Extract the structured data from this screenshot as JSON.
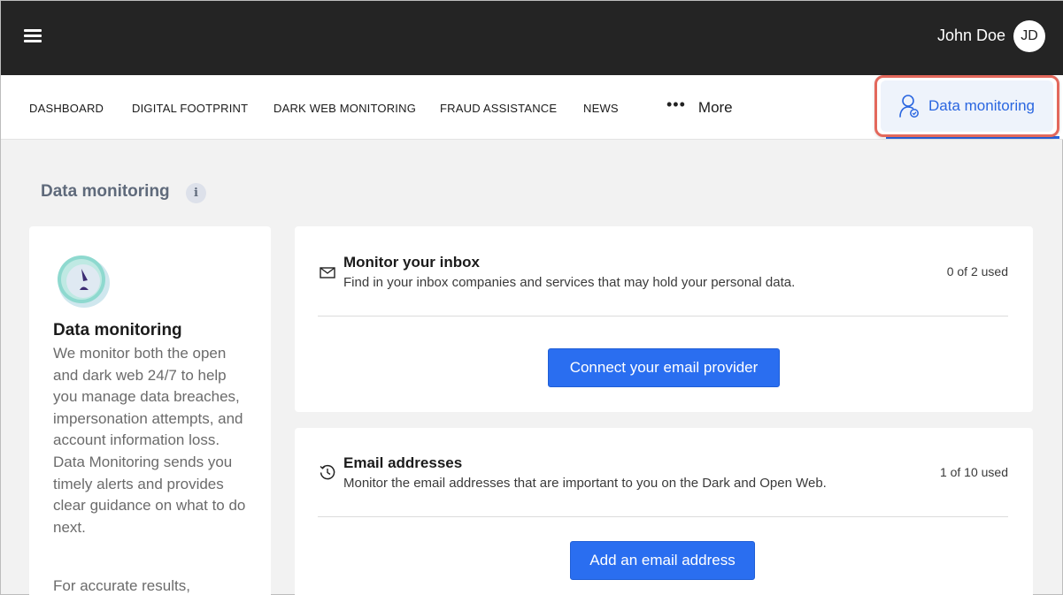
{
  "header": {
    "user_name": "John Doe",
    "avatar_initials": "JD"
  },
  "nav": {
    "items": [
      {
        "label": "DASHBOARD"
      },
      {
        "label": "DIGITAL FOOTPRINT"
      },
      {
        "label": "DARK WEB MONITORING"
      },
      {
        "label": "FRAUD ASSISTANCE"
      },
      {
        "label": "NEWS"
      }
    ],
    "more_label": "More",
    "active_tab_label": "Data monitoring"
  },
  "page": {
    "title": "Data monitoring",
    "info_icon_glyph": "i"
  },
  "info_panel": {
    "title": "Data monitoring",
    "description": "We monitor both the open and dark web 24/7 to help you manage data breaches, impersonation attempts, and account information loss. Data Monitoring sends you timely alerts and provides clear guidance on what to do next.",
    "description2": "For accurate results,"
  },
  "cards": [
    {
      "icon": "mail-icon",
      "title": "Monitor your inbox",
      "subtitle": "Find in your inbox companies and services that may hold your personal data.",
      "count": "0 of 2 used",
      "button_label": "Connect your email provider"
    },
    {
      "icon": "history-icon",
      "title": "Email addresses",
      "subtitle": "Monitor the email addresses that are important to you on the Dark and Open Web.",
      "count": "1 of 10 used",
      "button_label": "Add an email address"
    }
  ],
  "colors": {
    "accent": "#2a6ef0",
    "highlight": "#e3685c",
    "topbar": "#242424"
  }
}
